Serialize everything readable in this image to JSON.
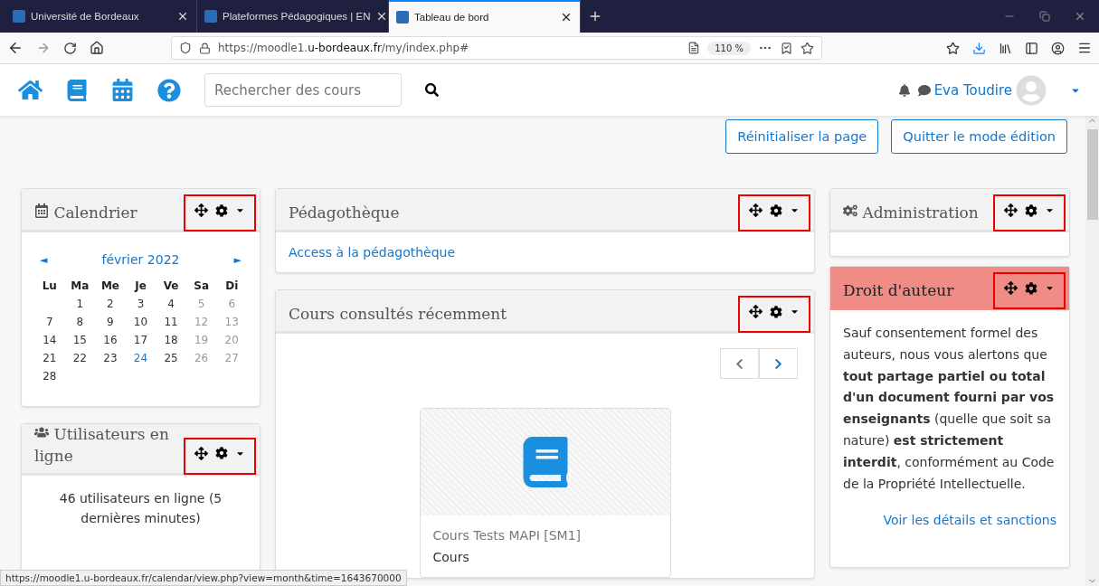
{
  "browser": {
    "tabs": [
      {
        "title": "Université de Bordeaux",
        "selected": false
      },
      {
        "title": "Plateformes Pédagogiques | EN",
        "selected": false
      },
      {
        "title": "Tableau de bord",
        "selected": true
      }
    ],
    "url_prefix": "https://moodle1.",
    "url_domain": "u-bordeaux.fr",
    "url_path": "/my/index.php#",
    "zoom": "110 %"
  },
  "navbar": {
    "search_placeholder": "Rechercher des cours",
    "user": "Eva Toudire"
  },
  "page_buttons": [
    "Réinitialiser la page",
    "Quitter le mode édition"
  ],
  "calendar": {
    "title": "Calendrier",
    "highlighted": true,
    "prev": "◄",
    "next": "►",
    "month": "février 2022",
    "weekdays": [
      "Lu",
      "Ma",
      "Me",
      "Je",
      "Ve",
      "Sa",
      "Di"
    ],
    "weeks": [
      [
        {
          "kind": "blank"
        },
        {
          "kind": "day",
          "d": "1",
          "weekend": false,
          "today": false
        },
        {
          "kind": "day",
          "d": "2",
          "weekend": false,
          "today": false
        },
        {
          "kind": "day",
          "d": "3",
          "weekend": false,
          "today": false
        },
        {
          "kind": "day",
          "d": "4",
          "weekend": false,
          "today": false
        },
        {
          "kind": "day",
          "d": "5",
          "weekend": true,
          "today": false
        },
        {
          "kind": "day",
          "d": "6",
          "weekend": true,
          "today": false
        }
      ],
      [
        {
          "kind": "day",
          "d": "7",
          "weekend": false,
          "today": false
        },
        {
          "kind": "day",
          "d": "8",
          "weekend": false,
          "today": false
        },
        {
          "kind": "day",
          "d": "9",
          "weekend": false,
          "today": false
        },
        {
          "kind": "day",
          "d": "10",
          "weekend": false,
          "today": false
        },
        {
          "kind": "day",
          "d": "11",
          "weekend": false,
          "today": false
        },
        {
          "kind": "day",
          "d": "12",
          "weekend": true,
          "today": false
        },
        {
          "kind": "day",
          "d": "13",
          "weekend": true,
          "today": false
        }
      ],
      [
        {
          "kind": "day",
          "d": "14",
          "weekend": false,
          "today": false
        },
        {
          "kind": "day",
          "d": "15",
          "weekend": false,
          "today": false
        },
        {
          "kind": "day",
          "d": "16",
          "weekend": false,
          "today": false
        },
        {
          "kind": "day",
          "d": "17",
          "weekend": false,
          "today": false
        },
        {
          "kind": "day",
          "d": "18",
          "weekend": false,
          "today": false
        },
        {
          "kind": "day",
          "d": "19",
          "weekend": true,
          "today": false
        },
        {
          "kind": "day",
          "d": "20",
          "weekend": true,
          "today": false
        }
      ],
      [
        {
          "kind": "day",
          "d": "21",
          "weekend": false,
          "today": false
        },
        {
          "kind": "day",
          "d": "22",
          "weekend": false,
          "today": false
        },
        {
          "kind": "day",
          "d": "23",
          "weekend": false,
          "today": false
        },
        {
          "kind": "day",
          "d": "24",
          "weekend": false,
          "today": true
        },
        {
          "kind": "day",
          "d": "25",
          "weekend": false,
          "today": false
        },
        {
          "kind": "day",
          "d": "26",
          "weekend": true,
          "today": false
        },
        {
          "kind": "day",
          "d": "27",
          "weekend": true,
          "today": false
        }
      ],
      [
        {
          "kind": "day",
          "d": "28",
          "weekend": false,
          "today": false
        }
      ]
    ]
  },
  "online_users": {
    "title": "Utilisateurs en ligne",
    "highlighted": true,
    "text": "46 utilisateurs en ligne (5 dernières minutes)"
  },
  "pedagotheque": {
    "title": "Pédagothèque",
    "highlighted": true,
    "link": "Access à la pédagothèque"
  },
  "recent_courses": {
    "title": "Cours consultés récemment",
    "highlighted": true,
    "prev_disabled": true,
    "next_disabled": false,
    "course": {
      "name": "Cours Tests MAPI [SM1]",
      "type": "Cours"
    }
  },
  "administration": {
    "title": "Administration",
    "highlighted": true
  },
  "copyright": {
    "title": "Droit d'auteur",
    "highlighted": true,
    "text": "Sauf consentement formel des auteurs, nous vous alertons que **tout partage partiel ou total d'un document fourni par vos enseignants** (quelle que soit sa nature) **est strictement interdit**, conformément au Code de la Propriété Intellectuelle.",
    "link": "Voir les détails et sanctions"
  },
  "status_url": "https://moodle1.u-bordeaux.fr/calendar/view.php?view=month&time=1643670000"
}
